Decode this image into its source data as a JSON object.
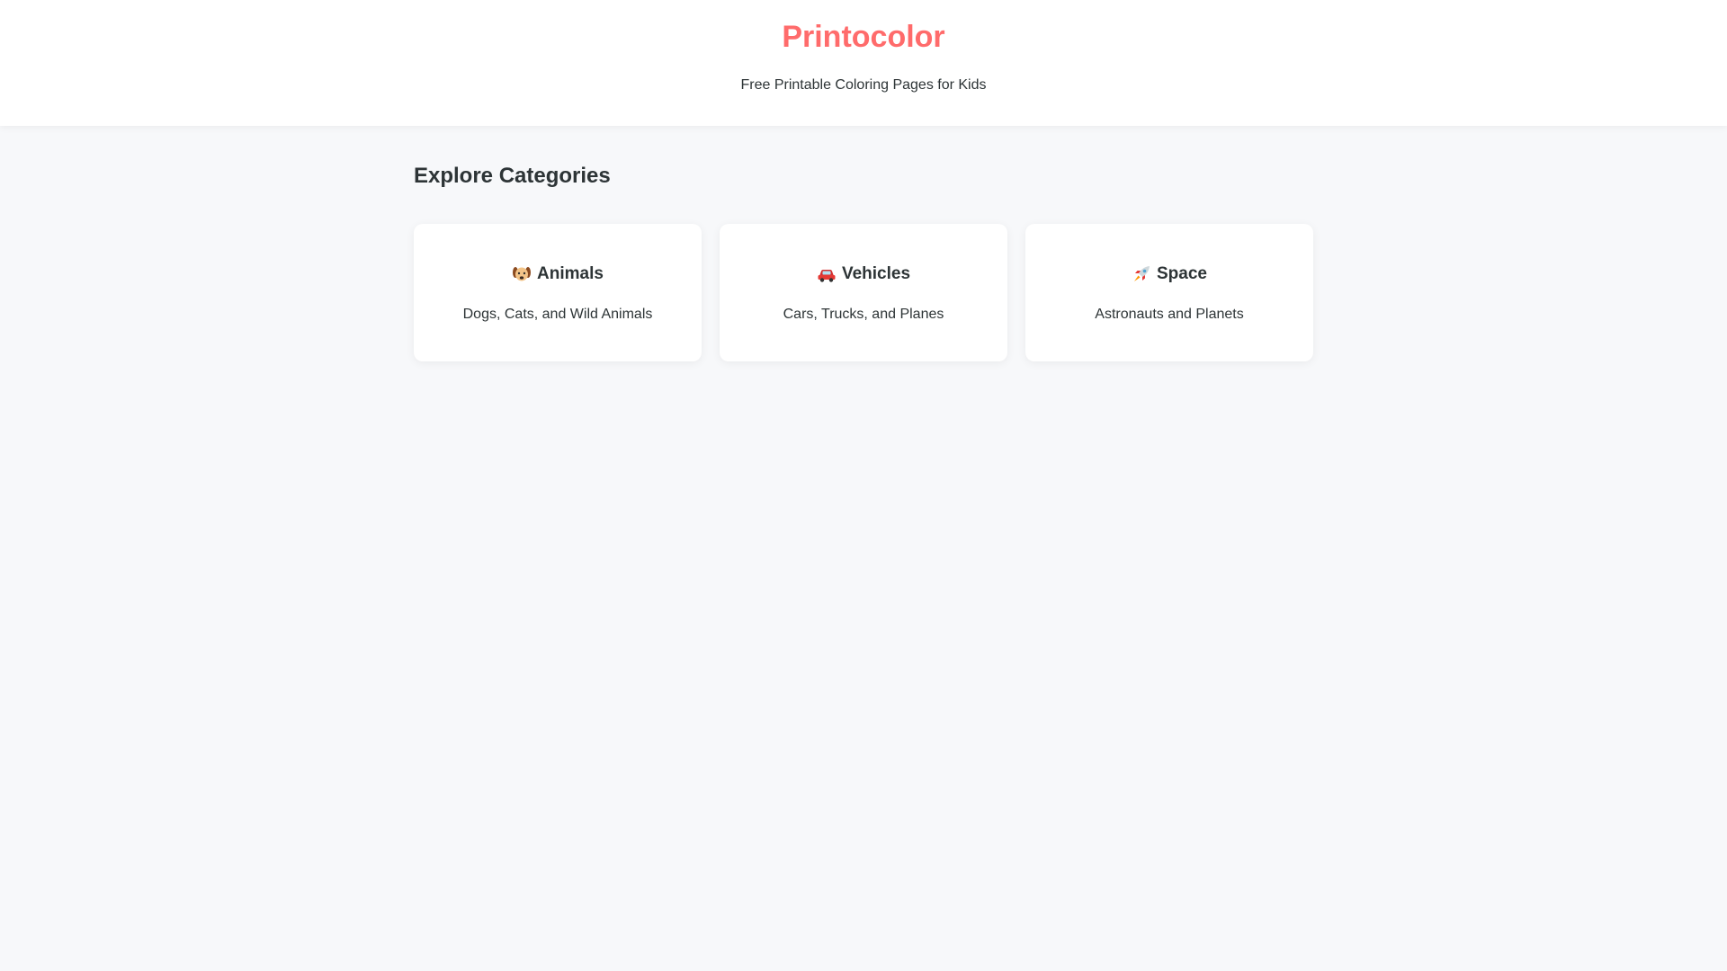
{
  "header": {
    "brand": "Printocolor",
    "tagline": "Free Printable Coloring Pages for Kids"
  },
  "main": {
    "section_title": "Explore Categories",
    "categories": [
      {
        "icon": "dog-face-icon",
        "title": "Animals",
        "description": "Dogs, Cats, and Wild Animals"
      },
      {
        "icon": "red-car-icon",
        "title": "Vehicles",
        "description": "Cars, Trucks, and Planes"
      },
      {
        "icon": "rocket-icon",
        "title": "Space",
        "description": "Astronauts and Planets"
      }
    ]
  },
  "colors": {
    "brand": "#ff6b6b",
    "text": "#2d3436",
    "page_background": "#f7f8fa",
    "card_background": "#ffffff"
  }
}
